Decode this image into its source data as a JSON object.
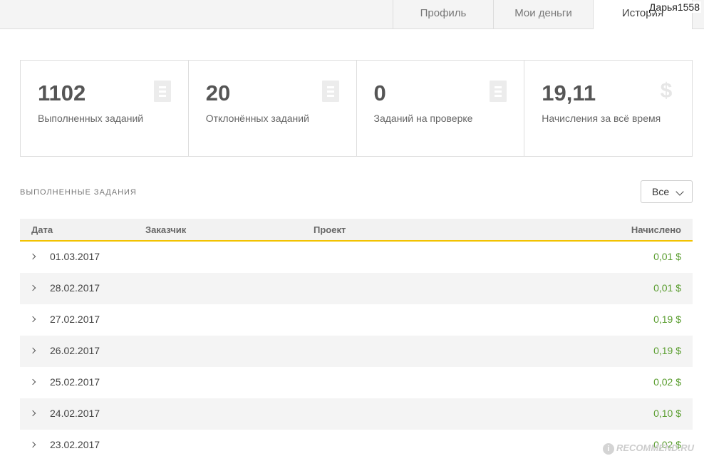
{
  "tabs": [
    {
      "label": "Профиль"
    },
    {
      "label": "Мои деньги"
    },
    {
      "label": "История",
      "active": true
    }
  ],
  "user": {
    "name": "Дарья1558"
  },
  "stats": [
    {
      "value": "1102",
      "label": "Выполненных заданий",
      "icon": "document-icon"
    },
    {
      "value": "20",
      "label": "Отклонённых заданий",
      "icon": "document-icon"
    },
    {
      "value": "0",
      "label": "Заданий на проверке",
      "icon": "document-icon"
    },
    {
      "value": "19,11",
      "label": "Начисления за всё время",
      "icon": "dollar-icon"
    }
  ],
  "section": {
    "title": "ВЫПОЛНЕННЫЕ ЗАДАНИЯ",
    "filter_value": "Все"
  },
  "table": {
    "headers": {
      "date": "Дата",
      "customer": "Заказчик",
      "project": "Проект",
      "amount": "Начислено"
    },
    "rows": [
      {
        "date": "01.03.2017",
        "amount": "0,01 $"
      },
      {
        "date": "28.02.2017",
        "amount": "0,01 $"
      },
      {
        "date": "27.02.2017",
        "amount": "0,19 $"
      },
      {
        "date": "26.02.2017",
        "amount": "0,19 $"
      },
      {
        "date": "25.02.2017",
        "amount": "0,02 $"
      },
      {
        "date": "24.02.2017",
        "amount": "0,10 $"
      },
      {
        "date": "23.02.2017",
        "amount": "0,02 $"
      }
    ]
  },
  "colors": {
    "accent": "#f2c200",
    "amount": "#5a9d2f"
  },
  "watermark": {
    "text": "RECOMMEND.RU",
    "badge": "i"
  }
}
